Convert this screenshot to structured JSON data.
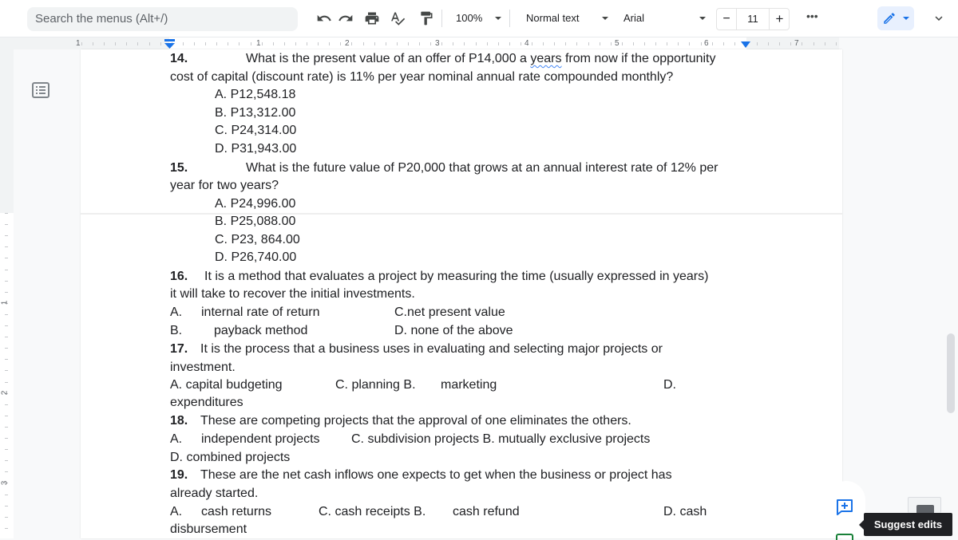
{
  "toolbar": {
    "search_placeholder": "Search the menus (Alt+/)",
    "icons": [
      "undo-icon",
      "redo-icon",
      "print-icon",
      "spellcheck-icon",
      "paint-format-icon"
    ],
    "zoom": "100%",
    "style": "Normal text",
    "font": "Arial",
    "font_size_minus": "−",
    "font_size": "11",
    "font_size_plus": "+",
    "more": "•••",
    "edit_mode_icon": "pencil-icon"
  },
  "ruler": {
    "numbers": [
      "1",
      "1",
      "2",
      "3",
      "4",
      "5",
      "6",
      "7"
    ],
    "vertical_numbers": [
      "1",
      "2",
      "3"
    ]
  },
  "document": {
    "q14": {
      "num": "14.",
      "line1": "What is the present value of an offer of P14,000 a ",
      "squiggle_word": "years",
      "line1_end": " from now if the opportunity",
      "line2": "cost of capital (discount rate) is 11% per year nominal annual rate compounded monthly?",
      "choices": [
        "A. P12,548.18",
        "B. P13,312.00",
        "C. P24,314.00",
        "D. P31,943.00"
      ]
    },
    "q15": {
      "num": "15.",
      "line1": "What is the future value of P20,000 that grows at an annual interest rate of 12% per",
      "line2": "year for two years?",
      "choices": [
        "A. P24,996.00",
        "B. P25,088.00",
        "C. P23, 864.00",
        "D. P26,740.00"
      ]
    },
    "q16": {
      "num": "16.",
      "line1": "It is a method that evaluates a project by measuring the time (usually expressed in years)",
      "line2": "it will take to recover the initial investments.",
      "a_label": "A.",
      "a_text": "internal rate of return",
      "c_text": "C.net present value",
      "b_label": "B.",
      "b_text": "payback method",
      "d_text": "D. none of the above"
    },
    "q17": {
      "num": "17.",
      "line1": "It is the process that a business uses in evaluating and selecting major projects or",
      "line2": "investment.",
      "a_text": "A. capital budgeting",
      "c_text": "C. planning B.",
      "b_text": "marketing",
      "d_label": "D.",
      "d_text": "expenditures"
    },
    "q18": {
      "num": "18.",
      "line1": "These are competing projects that the approval of one eliminates the others.",
      "a_label": "A.",
      "a_text": "independent projects",
      "cb_text": "C. subdivision projects B. mutually exclusive projects",
      "d_text": "D. combined projects"
    },
    "q19": {
      "num": "19.",
      "line1": "These are the net cash inflows one expects to get when the business or project has",
      "line2": "already started.",
      "a_label": "A.",
      "a_text": "cash returns",
      "c_text": "C. cash receipts B.",
      "b_text": "cash refund",
      "d_text": "D. cash",
      "d_text2": "disbursement"
    }
  },
  "side": {
    "tooltip": "Suggest edits"
  },
  "colors": {
    "accent": "#1a73e8",
    "toolbar_bg": "#ffffff",
    "canvas_bg": "#f8f9fa",
    "tooltip_bg": "#202124"
  }
}
